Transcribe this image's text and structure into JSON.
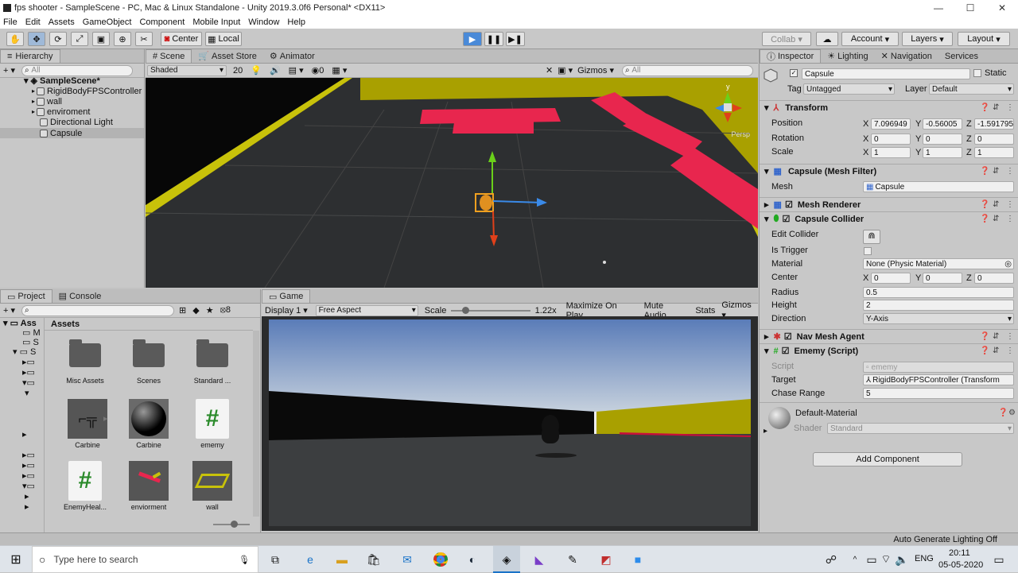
{
  "window": {
    "title": "fps shooter - SampleScene - PC, Mac & Linux Standalone - Unity 2019.3.0f6 Personal* <DX11>",
    "min": "—",
    "max": "☐",
    "close": "✕"
  },
  "menu": [
    "File",
    "Edit",
    "Assets",
    "GameObject",
    "Component",
    "Mobile Input",
    "Window",
    "Help"
  ],
  "toolbar": {
    "pivot": "Center",
    "space": "Local",
    "collab": "Collab ▾",
    "account": "Account",
    "layers": "Layers",
    "layout": "Layout"
  },
  "hierarchy": {
    "tab": "Hierarchy",
    "search_placeholder": "All",
    "scene": "SampleScene*",
    "items": [
      "RigidBodyFPSController",
      "wall",
      "enviroment",
      "Directional Light",
      "Capsule"
    ]
  },
  "scene_view": {
    "tabs": [
      "Scene",
      "Asset Store",
      "Animator"
    ],
    "shading": "Shaded",
    "mode_2d": "20",
    "hidden_count": "0",
    "gizmos": "Gizmos",
    "search_placeholder": "All",
    "persp": "Persp",
    "axis_y": "y"
  },
  "project": {
    "tabs": [
      "Project",
      "Console"
    ],
    "count": "8",
    "tree": [
      "Ass",
      "M",
      "S",
      "S"
    ],
    "breadcrumb": "Assets",
    "assets": [
      "Misc Assets",
      "Scenes",
      "Standard ...",
      "Carbine",
      "Carbine",
      "ememy",
      "EnemyHeal...",
      "enviorment",
      "wall"
    ]
  },
  "game_view": {
    "tab": "Game",
    "display": "Display 1",
    "aspect": "Free Aspect",
    "scale_label": "Scale",
    "scale_value": "1.22x",
    "maximize": "Maximize On Play",
    "mute": "Mute Audio",
    "stats": "Stats",
    "gizmos": "Gizmos"
  },
  "inspector": {
    "tabs": [
      "Inspector",
      "Lighting",
      "Navigation",
      "Services"
    ],
    "object_name": "Capsule",
    "static_label": "Static",
    "tag_label": "Tag",
    "tag_value": "Untagged",
    "layer_label": "Layer",
    "layer_value": "Default",
    "transform": {
      "title": "Transform",
      "position_label": "Position",
      "position": [
        "7.096949",
        "-0.56005",
        "-1.591795"
      ],
      "rotation_label": "Rotation",
      "rotation": [
        "0",
        "0",
        "0"
      ],
      "scale_label": "Scale",
      "scale": [
        "1",
        "1",
        "1"
      ]
    },
    "mesh_filter": {
      "title": "Capsule (Mesh Filter)",
      "mesh_label": "Mesh",
      "mesh_value": "Capsule"
    },
    "mesh_renderer": {
      "title": "Mesh Renderer"
    },
    "collider": {
      "title": "Capsule Collider",
      "edit_label": "Edit Collider",
      "trigger_label": "Is Trigger",
      "material_label": "Material",
      "material_value": "None (Physic Material)",
      "center_label": "Center",
      "center": [
        "0",
        "0",
        "0"
      ],
      "radius_label": "Radius",
      "radius": "0.5",
      "height_label": "Height",
      "height": "2",
      "direction_label": "Direction",
      "direction": "Y-Axis"
    },
    "nav_agent": {
      "title": "Nav Mesh Agent"
    },
    "script": {
      "title": "Ememy (Script)",
      "script_label": "Script",
      "script_value": "ememy",
      "target_label": "Target",
      "target_value": "RigidBodyFPSController (Transform",
      "chase_label": "Chase Range",
      "chase_value": "5"
    },
    "material": {
      "name": "Default-Material",
      "shader_label": "Shader",
      "shader_value": "Standard"
    },
    "add_component": "Add Component"
  },
  "status": {
    "lighting": "Auto Generate Lighting Off"
  },
  "taskbar": {
    "search_placeholder": "Type here to search",
    "lang": "ENG",
    "time": "20:11",
    "date": "05-05-2020"
  }
}
